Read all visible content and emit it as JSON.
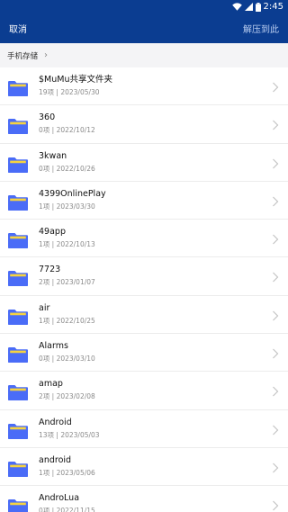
{
  "status_bar": {
    "time": "2:45",
    "icons": [
      "wifi-icon",
      "signal-icon",
      "battery-icon"
    ]
  },
  "toolbar": {
    "cancel_label": "取消",
    "extract_here_label": "解压到此"
  },
  "breadcrumb": {
    "root_label": "手机存储"
  },
  "colors": {
    "header_bg": "#0b3d91",
    "folder_body": "#4a6cf7",
    "folder_tab": "#f6d33f"
  },
  "folders": [
    {
      "name": "$MuMu共享文件夹",
      "meta": "19项 | 2023/05/30"
    },
    {
      "name": "360",
      "meta": "0项 | 2022/10/12"
    },
    {
      "name": "3kwan",
      "meta": "0项 | 2022/10/26"
    },
    {
      "name": "4399OnlinePlay",
      "meta": "1项 | 2023/03/30"
    },
    {
      "name": "49app",
      "meta": "1项 | 2022/10/13"
    },
    {
      "name": "7723",
      "meta": "2项 | 2023/01/07"
    },
    {
      "name": "air",
      "meta": "1项 | 2022/10/25"
    },
    {
      "name": "Alarms",
      "meta": "0项 | 2023/03/10"
    },
    {
      "name": "amap",
      "meta": "2项 | 2023/02/08"
    },
    {
      "name": "Android",
      "meta": "13项 | 2023/05/03"
    },
    {
      "name": "android",
      "meta": "1项 | 2023/05/06"
    },
    {
      "name": "AndroLua",
      "meta": "0项 | 2022/11/15"
    }
  ]
}
